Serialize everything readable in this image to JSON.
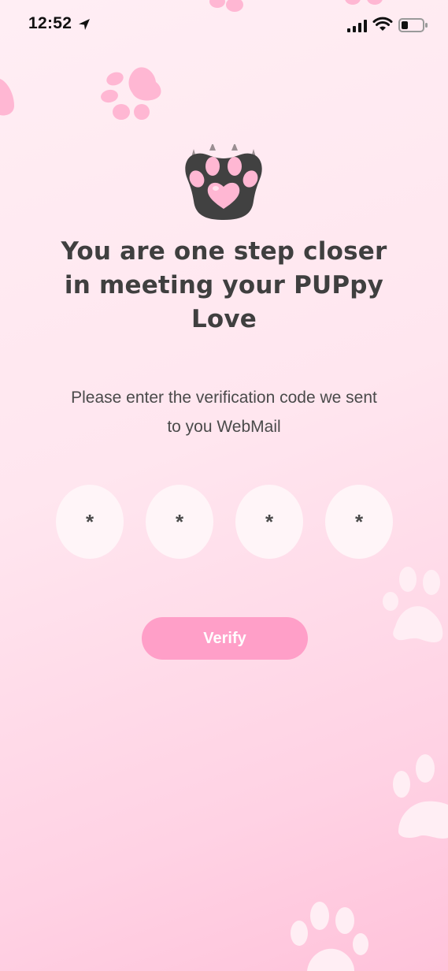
{
  "status_bar": {
    "time": "12:52",
    "icons": [
      "location-arrow-icon",
      "cellular-signal-icon",
      "wifi-icon",
      "battery-icon"
    ]
  },
  "colors": {
    "accent": "#ff9fc8",
    "paw_pink": "#ffb7d3",
    "logo_dark": "#414141",
    "heading_text": "#3f3f3f"
  },
  "verification": {
    "heading": "You are one step closer in meeting your PUPpy Love",
    "instruction": "Please enter the verification code we sent to you WebMail",
    "code_digits": [
      "*",
      "*",
      "*",
      "*"
    ],
    "verify_label": "Verify"
  }
}
